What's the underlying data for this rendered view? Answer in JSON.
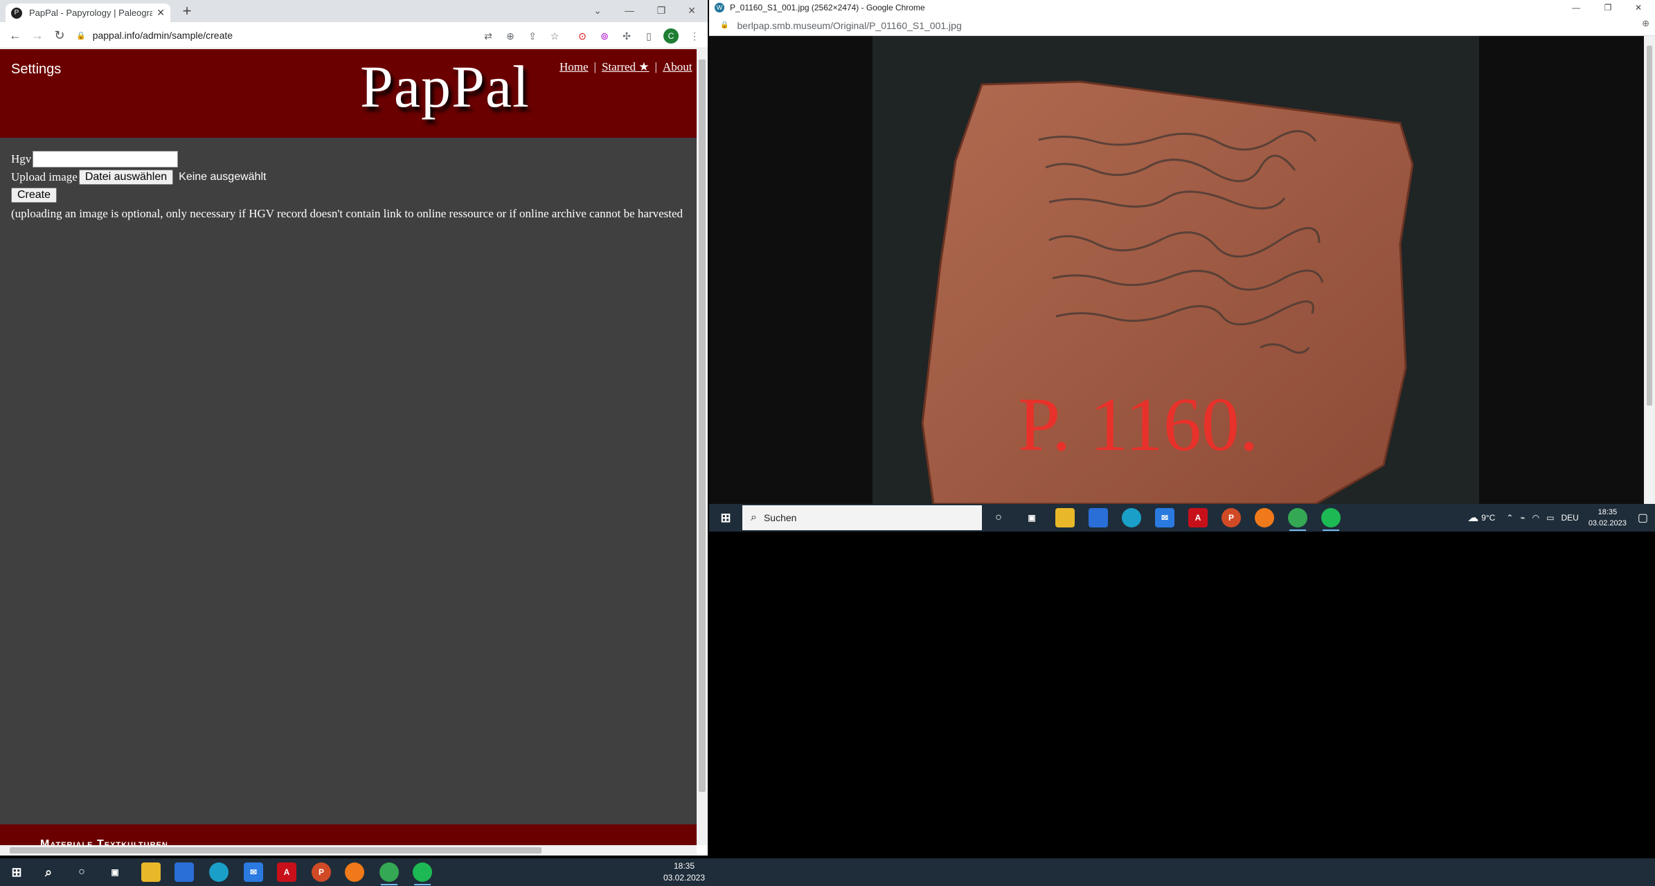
{
  "left_window": {
    "tab_title": "PapPal - Papyrology | Paleograph",
    "url": "pappal.info/admin/sample/create"
  },
  "page": {
    "settings": "Settings",
    "logo": "PapPal",
    "nav": {
      "home": "Home",
      "sep1": "|",
      "starred": "Starred ★",
      "sep2": "|",
      "about": "About"
    },
    "form": {
      "hgv_label": "Hgv",
      "upload_label": "Upload image",
      "file_button": "Datei auswählen",
      "no_file": "Keine ausgewählt",
      "create_button": "Create",
      "note": "(uploading an image is optional, only necessary if HGV record doesn't contain link to online ressource or if online archive cannot be harvested"
    },
    "footer": "Materiale Textkulturen"
  },
  "right_window": {
    "title": "P_01160_S1_001.jpg (2562×2474) - Google Chrome",
    "url": "berlpap.smb.museum/Original/P_01160_S1_001.jpg",
    "image_inscription": "P. 1160."
  },
  "right_taskbar": {
    "search_placeholder": "Suchen",
    "weather": "9°C",
    "lang": "DEU",
    "time": "18:35",
    "date": "03.02.2023"
  },
  "main_taskbar": {
    "time": "18:35",
    "date": "03.02.2023"
  },
  "colors": {
    "banner": "#6b0000",
    "page_bg": "#404040",
    "taskbar": "#1f2d3a"
  }
}
